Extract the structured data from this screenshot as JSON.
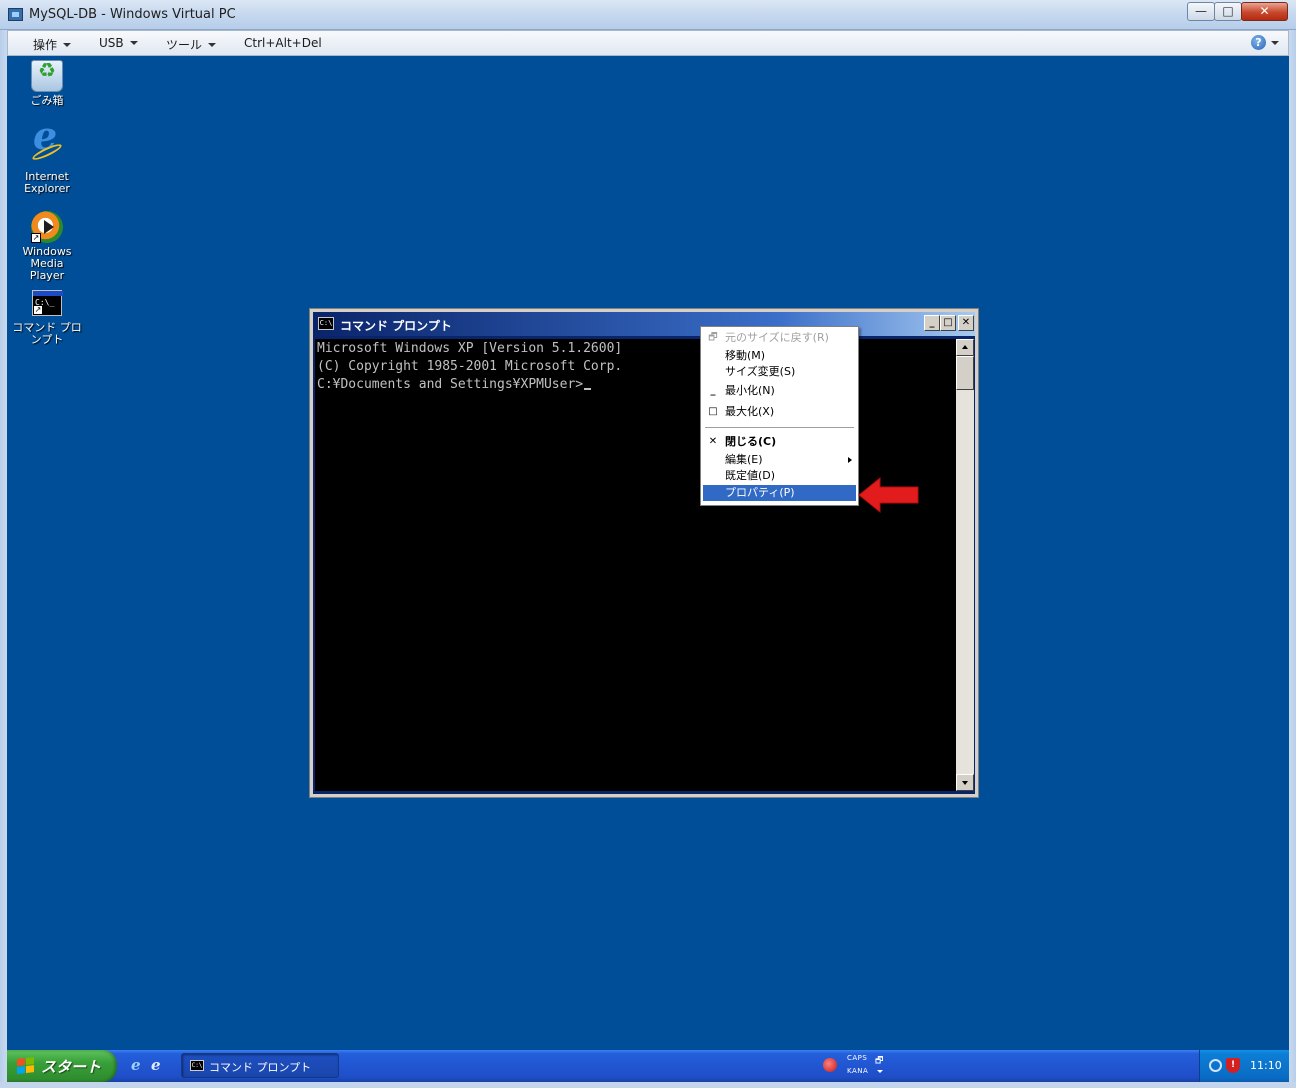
{
  "host": {
    "title": "MySQL-DB - Windows Virtual PC",
    "buttons": {
      "minimize": "—",
      "maximize": "□",
      "close": "✕"
    },
    "menu": [
      {
        "label": "操作"
      },
      {
        "label": "USB"
      },
      {
        "label": "ツール"
      },
      {
        "label": "Ctrl+Alt+Del"
      }
    ],
    "help_icon": "?"
  },
  "desktop": {
    "icons": [
      {
        "name": "recycle-bin",
        "label": "ごみ箱"
      },
      {
        "name": "internet-explorer",
        "label": "Internet Explorer"
      },
      {
        "name": "windows-media-player",
        "label": "Windows Media Player"
      },
      {
        "name": "command-prompt-shortcut",
        "label": "コマンド プロンプト"
      }
    ],
    "shortcut_glyph": "↗"
  },
  "cmd_window": {
    "title": "コマンド プロンプト",
    "icon_text": "C:\\",
    "buttons": {
      "minimize": "_",
      "maximize": "□",
      "close": "✕"
    },
    "lines": [
      "Microsoft Windows XP [Version 5.1.2600]",
      "(C) Copyright 1985-2001 Microsoft Corp.",
      "",
      "C:¥Documents and Settings¥XPMUser>"
    ]
  },
  "system_menu": {
    "items": [
      {
        "label": "元のサイズに戻す(R)",
        "icon": "restore-icon",
        "glyph": "🗗",
        "state": "disabled"
      },
      {
        "label": "移動(M)",
        "icon": "",
        "glyph": "",
        "state": "normal"
      },
      {
        "label": "サイズ変更(S)",
        "icon": "",
        "glyph": "",
        "state": "normal"
      },
      {
        "label": "最小化(N)",
        "icon": "minimize-icon",
        "glyph": "_",
        "state": "normal"
      },
      {
        "label": "最大化(X)",
        "icon": "maximize-icon",
        "glyph": "□",
        "state": "normal"
      },
      {
        "label": "閉じる(C)",
        "icon": "close-icon",
        "glyph": "✕",
        "state": "bold"
      },
      {
        "label": "編集(E)",
        "icon": "",
        "glyph": "",
        "state": "submenu"
      },
      {
        "label": "既定値(D)",
        "icon": "",
        "glyph": "",
        "state": "normal"
      },
      {
        "label": "プロパティ(P)",
        "icon": "",
        "glyph": "",
        "state": "selected"
      }
    ]
  },
  "annotation": {
    "arrow_color": "#e21c1c"
  },
  "taskbar": {
    "start_label": "スタート",
    "quick_launch": {
      "ie": "e",
      "desktop": "e"
    },
    "tasks": [
      {
        "label": "コマンド プロンプト",
        "icon_text": "C:\\"
      }
    ],
    "language_bar": {
      "caps": "CAPS",
      "kana": "KANA",
      "restore": "🗗"
    },
    "tray": {
      "shield": "!",
      "clock": "11:10"
    }
  },
  "colors": {
    "desktop_bg": "#004e98",
    "taskbar_blue": "#245edb",
    "start_green": "#38a038",
    "menu_selected": "#316ac5",
    "xp_title_blue": "#0a246a"
  }
}
